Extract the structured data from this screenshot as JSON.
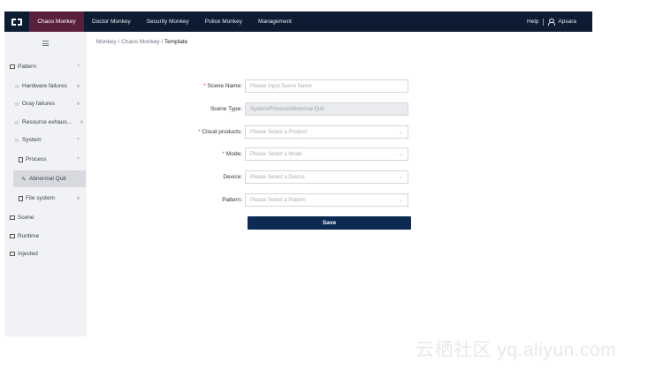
{
  "header": {
    "nav": [
      "Chaos Monkey",
      "Doctor Monkey",
      "Security Monkey",
      "Police Monkey",
      "Management"
    ],
    "help": "Help",
    "user": "Apsara"
  },
  "sidebar": {
    "items": [
      {
        "label": "Pattern",
        "icon": "square-icon",
        "chevron": "^"
      },
      {
        "label": "Hardware failures",
        "icon": "star-icon",
        "chevron": "v"
      },
      {
        "label": "Gray failures",
        "icon": "star-icon",
        "chevron": "v"
      },
      {
        "label": "Resource exhaus...",
        "icon": "star-icon",
        "chevron": "v"
      },
      {
        "label": "System",
        "icon": "star-icon",
        "chevron": "^"
      },
      {
        "label": "Process",
        "icon": "doc-icon",
        "chevron": "^"
      },
      {
        "label": "Abnormal Quit",
        "icon": "pen-icon",
        "chevron": ""
      },
      {
        "label": "File system",
        "icon": "doc-icon",
        "chevron": "v"
      },
      {
        "label": "Scene",
        "icon": "square-icon",
        "chevron": ""
      },
      {
        "label": "Runtime",
        "icon": "square-icon",
        "chevron": ""
      },
      {
        "label": "Injected",
        "icon": "square-icon",
        "chevron": ""
      }
    ]
  },
  "breadcrumb": [
    "Monkey",
    "Chaos Monkey",
    "Template"
  ],
  "form": {
    "scene_name": {
      "label": "Scene Name",
      "placeholder": "Please Input Scene Name"
    },
    "scene_type": {
      "label": "Scene Type",
      "value": "System/Process/Abnormal Quit"
    },
    "cloud_products": {
      "label": "Cloud products",
      "placeholder": "Please Select a Product"
    },
    "mode": {
      "label": "Mode",
      "placeholder": "Please Select a Mode"
    },
    "device": {
      "label": "Device",
      "placeholder": "Please Select a Device"
    },
    "pattern": {
      "label": "Pattern",
      "placeholder": "Please Select a Pattern"
    },
    "save_label": "Save"
  },
  "watermark": "云栖社区 yq.aliyun.com",
  "colors": {
    "topbar": "#0d1c32",
    "active_nav": "#5a1f3d",
    "save_button": "#0d2b52",
    "required": "#e5342a"
  }
}
